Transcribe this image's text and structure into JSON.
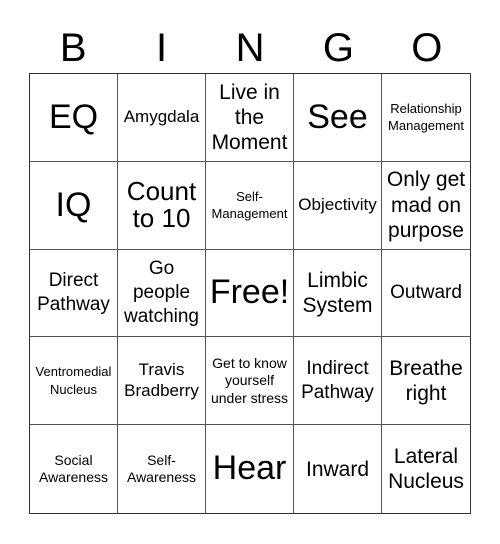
{
  "header": {
    "letters": [
      "B",
      "I",
      "N",
      "G",
      "O"
    ]
  },
  "card": {
    "cells": [
      {
        "text": "EQ",
        "size": "xl"
      },
      {
        "text": "Amygdala",
        "size": "s"
      },
      {
        "text": "Live in the Moment",
        "size": "m"
      },
      {
        "text": "See",
        "size": "xl"
      },
      {
        "text": "Relationship Management",
        "size": "xxs"
      },
      {
        "text": "IQ",
        "size": "xl"
      },
      {
        "text": "Count to 10",
        "size": "l"
      },
      {
        "text": "Self-Management",
        "size": "xxs"
      },
      {
        "text": "Objectivity",
        "size": "s"
      },
      {
        "text": "Only get mad on purpose",
        "size": "m"
      },
      {
        "text": "Direct Pathway",
        "size": "ms"
      },
      {
        "text": "Go people watching",
        "size": "ms"
      },
      {
        "text": "Free!",
        "size": "xl"
      },
      {
        "text": "Limbic System",
        "size": "m"
      },
      {
        "text": "Outward",
        "size": "ms"
      },
      {
        "text": "Ventromedial Nucleus",
        "size": "xxs"
      },
      {
        "text": "Travis Bradberry",
        "size": "s"
      },
      {
        "text": "Get to know yourself under stress",
        "size": "xs"
      },
      {
        "text": "Indirect Pathway",
        "size": "ms"
      },
      {
        "text": "Breathe right",
        "size": "m"
      },
      {
        "text": "Social Awareness",
        "size": "xs"
      },
      {
        "text": "Self-Awareness",
        "size": "xs"
      },
      {
        "text": "Hear",
        "size": "xl"
      },
      {
        "text": "Inward",
        "size": "m"
      },
      {
        "text": "Lateral Nucleus",
        "size": "m"
      }
    ]
  }
}
